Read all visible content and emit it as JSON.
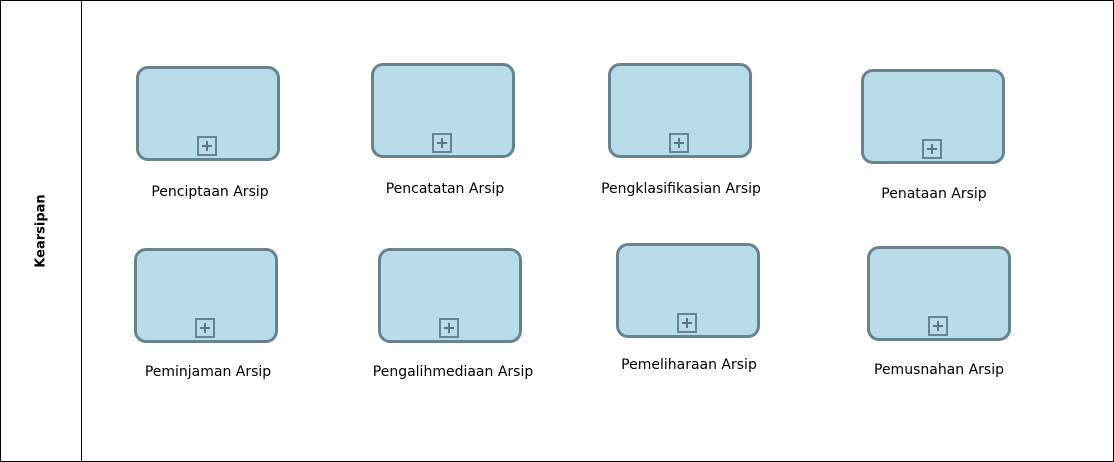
{
  "lane": {
    "label": "Kearsipan"
  },
  "colors": {
    "task_fill": "#b8dde9",
    "task_border": "#66838f",
    "border": "#000000"
  },
  "tasks": [
    {
      "label": "Penciptaan Arsip",
      "marker_icon": "plus-icon"
    },
    {
      "label": "Pencatatan Arsip",
      "marker_icon": "plus-icon"
    },
    {
      "label": "Pengklasifikasian Arsip",
      "marker_icon": "plus-icon"
    },
    {
      "label": "Penataan Arsip",
      "marker_icon": "plus-icon"
    },
    {
      "label": "Peminjaman Arsip",
      "marker_icon": "plus-icon"
    },
    {
      "label": "Pengalihmediaan Arsip",
      "marker_icon": "plus-icon"
    },
    {
      "label": "Pemeliharaan Arsip",
      "marker_icon": "plus-icon"
    },
    {
      "label": "Pemusnahan Arsip",
      "marker_icon": "plus-icon"
    }
  ]
}
